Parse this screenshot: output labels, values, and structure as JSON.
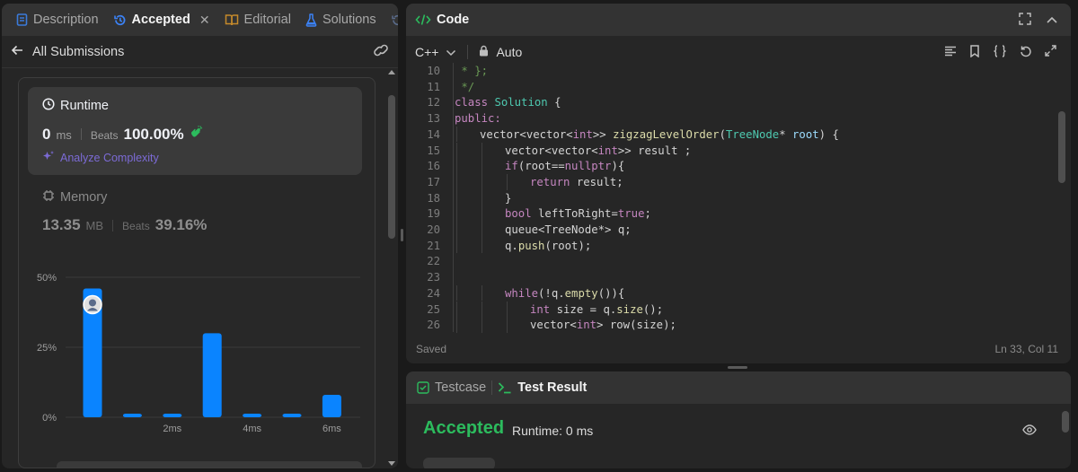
{
  "left_tabs": {
    "description": "Description",
    "accepted": "Accepted",
    "editorial": "Editorial",
    "solutions": "Solutions"
  },
  "submissions": {
    "back_label": "All Submissions"
  },
  "runtime": {
    "title": "Runtime",
    "value": "0",
    "unit": "ms",
    "beats_label": "Beats",
    "beats_value": "100.00%",
    "analyze_label": "Analyze Complexity"
  },
  "memory": {
    "title": "Memory",
    "value": "13.35",
    "unit": "MB",
    "beats_label": "Beats",
    "beats_value": "39.16%"
  },
  "chart_data": {
    "type": "bar",
    "y_ticks": [
      "50%",
      "25%",
      "0%"
    ],
    "x_ticks": [
      "2ms",
      "4ms",
      "6ms"
    ],
    "values": [
      46,
      1,
      1,
      30,
      1,
      1,
      8
    ],
    "ylim": [
      0,
      50
    ],
    "highlight_index": 0,
    "bar_color": "#0a84ff"
  },
  "code_panel": {
    "title": "Code",
    "language": "C++",
    "auto_label": "Auto",
    "saved_label": "Saved",
    "cursor_position": "Ln 33, Col 11"
  },
  "code_lines": [
    {
      "num": "10",
      "indent": 0,
      "tokens": [
        [
          " * };",
          "cm"
        ]
      ]
    },
    {
      "num": "11",
      "indent": 0,
      "tokens": [
        [
          " */",
          "cm"
        ]
      ]
    },
    {
      "num": "12",
      "indent": 0,
      "tokens": [
        [
          "class",
          "kw"
        ],
        [
          " ",
          "p"
        ],
        [
          "Solution",
          "ty"
        ],
        [
          " {",
          "p"
        ]
      ]
    },
    {
      "num": "13",
      "indent": 0,
      "tokens": [
        [
          "public:",
          "kw"
        ]
      ]
    },
    {
      "num": "14",
      "indent": 1,
      "tokens": [
        [
          "vector",
          "p"
        ],
        [
          "<",
          "p"
        ],
        [
          "vector",
          "p"
        ],
        [
          "<",
          "p"
        ],
        [
          "int",
          "kw"
        ],
        [
          ">> ",
          "p"
        ],
        [
          "zigzagLevelOrder",
          "fn"
        ],
        [
          "(",
          "p"
        ],
        [
          "TreeNode",
          "ty"
        ],
        [
          "* ",
          "p"
        ],
        [
          "root",
          "var"
        ],
        [
          ") {",
          "p"
        ]
      ]
    },
    {
      "num": "15",
      "indent": 2,
      "tokens": [
        [
          "vector<vector<",
          "p"
        ],
        [
          "int",
          "kw"
        ],
        [
          ">> result ;",
          "p"
        ]
      ]
    },
    {
      "num": "16",
      "indent": 2,
      "tokens": [
        [
          "if",
          "kw"
        ],
        [
          "(root==",
          "p"
        ],
        [
          "nullptr",
          "kw"
        ],
        [
          "){",
          "p"
        ]
      ]
    },
    {
      "num": "17",
      "indent": 3,
      "tokens": [
        [
          "return",
          "kw"
        ],
        [
          " result;",
          "p"
        ]
      ]
    },
    {
      "num": "18",
      "indent": 2,
      "tokens": [
        [
          "}",
          "p"
        ]
      ]
    },
    {
      "num": "19",
      "indent": 2,
      "tokens": [
        [
          "bool",
          "kw"
        ],
        [
          " leftToRight=",
          "p"
        ],
        [
          "true",
          "kw"
        ],
        [
          ";",
          "p"
        ]
      ]
    },
    {
      "num": "20",
      "indent": 2,
      "tokens": [
        [
          "queue<TreeNode*> q;",
          "p"
        ]
      ]
    },
    {
      "num": "21",
      "indent": 2,
      "tokens": [
        [
          "q",
          "p"
        ],
        [
          ".",
          "p"
        ],
        [
          "push",
          "fn"
        ],
        [
          "(root);",
          "p"
        ]
      ]
    },
    {
      "num": "22",
      "indent": 0,
      "tokens": []
    },
    {
      "num": "23",
      "indent": 0,
      "tokens": []
    },
    {
      "num": "24",
      "indent": 2,
      "tokens": [
        [
          "while",
          "kw"
        ],
        [
          "(!q.",
          "p"
        ],
        [
          "empty",
          "fn"
        ],
        [
          "()){",
          "p"
        ]
      ]
    },
    {
      "num": "25",
      "indent": 3,
      "tokens": [
        [
          "int",
          "kw"
        ],
        [
          " size = q.",
          "p"
        ],
        [
          "size",
          "fn"
        ],
        [
          "();",
          "p"
        ]
      ]
    },
    {
      "num": "26",
      "indent": 3,
      "tokens": [
        [
          "vector<",
          "p"
        ],
        [
          "int",
          "kw"
        ],
        [
          "> row(size);",
          "p"
        ]
      ]
    }
  ],
  "result_panel": {
    "testcase_label": "Testcase",
    "test_result_label": "Test Result",
    "status": "Accepted",
    "runtime": "Runtime: 0 ms"
  },
  "colors": {
    "accent_green": "#2cbb5d",
    "accent_blue": "#0a84ff",
    "keyword": "#c586c0",
    "type": "#4ec9b0",
    "function": "#dcdcaa",
    "variable": "#9cdcfe",
    "comment": "#6a9955"
  }
}
